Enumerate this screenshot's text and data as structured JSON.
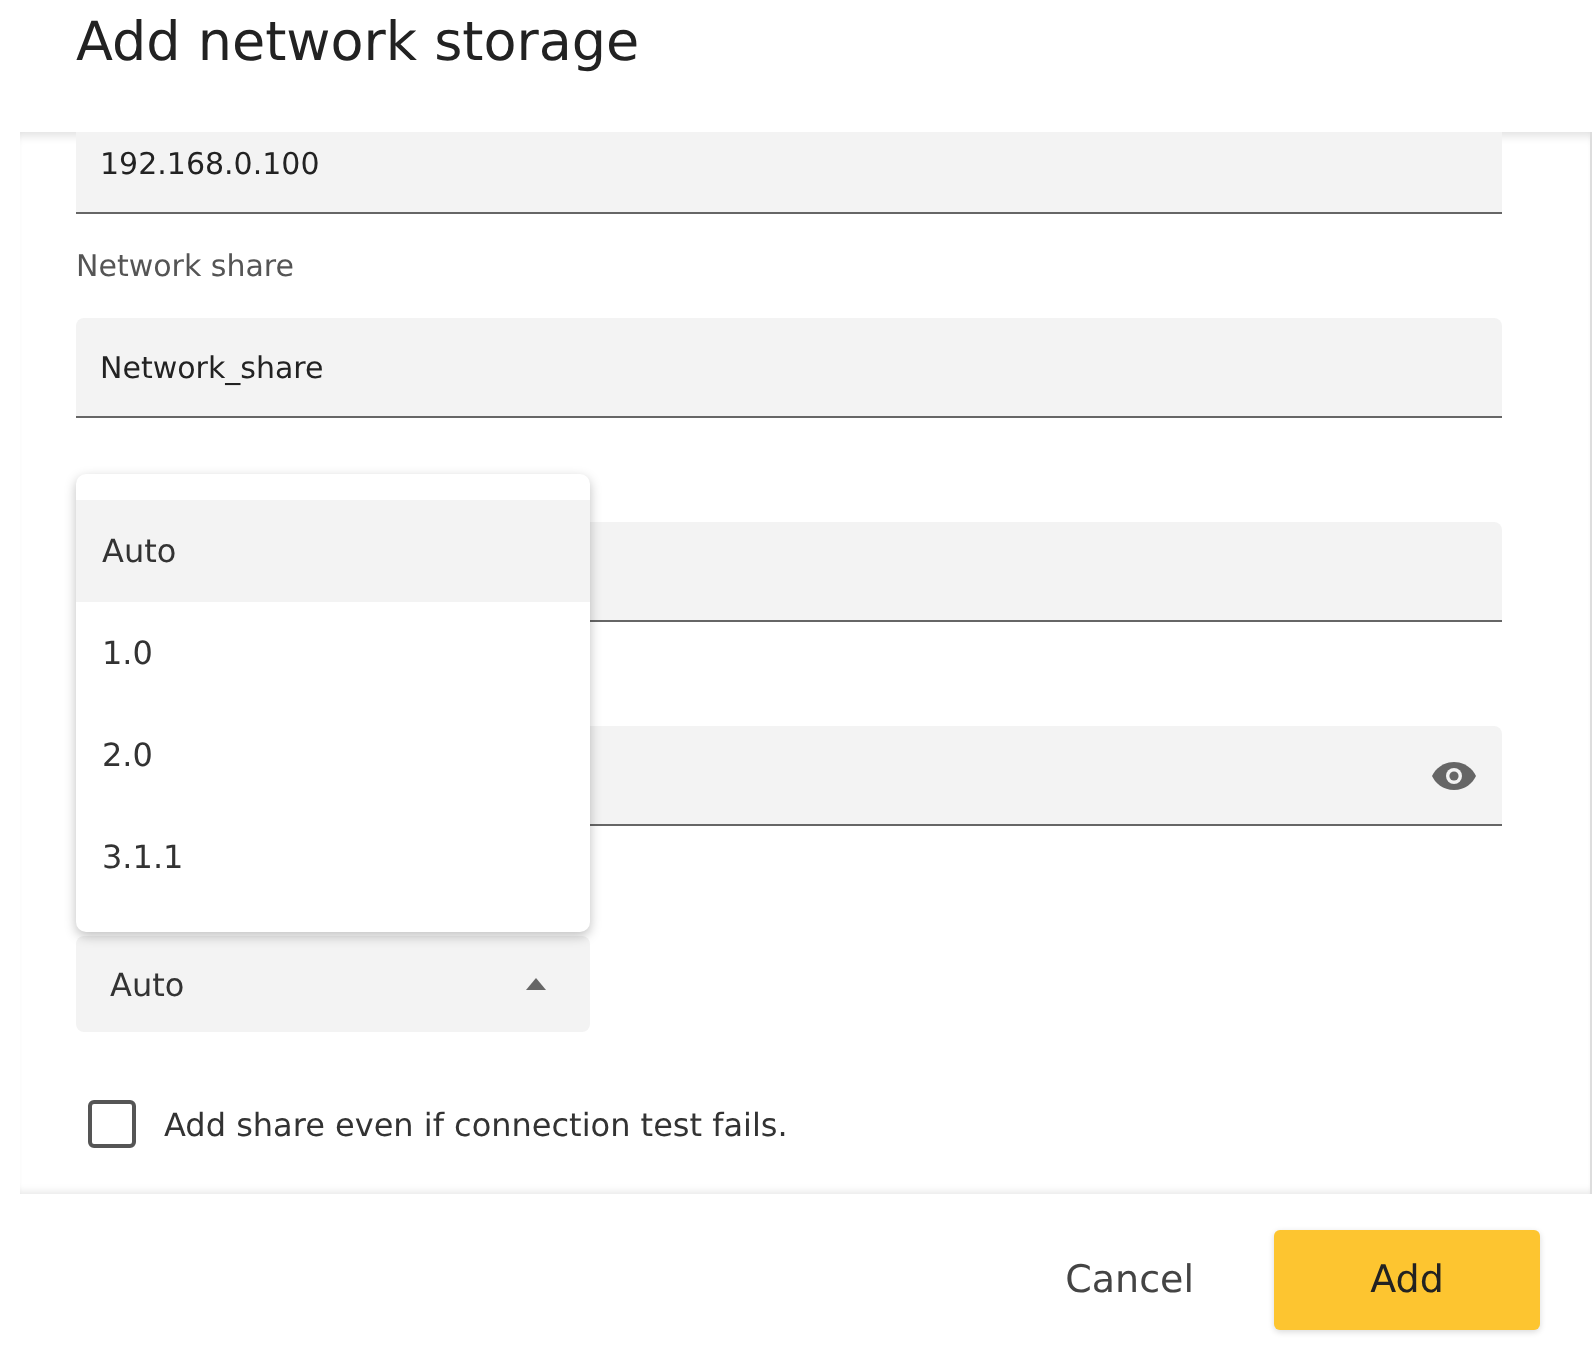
{
  "dialog": {
    "title": "Add network storage"
  },
  "fields": [
    {
      "kind": "text",
      "value": "192.168.0.100"
    },
    {
      "kind": "text",
      "label": "Network share",
      "value": "Network_share"
    },
    {
      "kind": "text"
    },
    {
      "kind": "password"
    },
    {
      "kind": "select",
      "value": "Auto",
      "expanded": true
    }
  ],
  "menu": [
    {
      "label": "Auto",
      "selected": true
    },
    {
      "label": "1.0",
      "selected": false
    },
    {
      "label": "2.0",
      "selected": false
    },
    {
      "label": "3.1.1",
      "selected": false
    }
  ],
  "checkbox": {
    "label": "Add share even if connection test fails.",
    "checked": false
  },
  "buttons": [
    {
      "kind": "text",
      "label": "Cancel"
    },
    {
      "kind": "primary",
      "label": "Add"
    }
  ]
}
